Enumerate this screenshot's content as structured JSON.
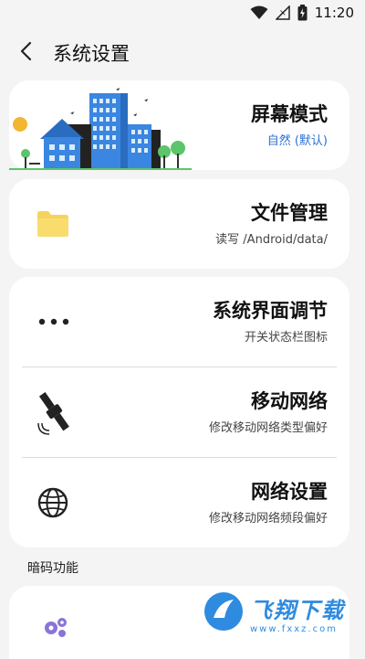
{
  "status_bar": {
    "time": "11:20",
    "icons": [
      "wifi-icon",
      "no-signal-icon",
      "battery-charging-icon"
    ]
  },
  "header": {
    "back_icon": "chevron-left-icon",
    "title": "系统设置"
  },
  "cards": {
    "display_mode": {
      "title": "屏幕模式",
      "subtitle": "自然 (默认)",
      "icon": "city-illustration"
    },
    "file_manager": {
      "title": "文件管理",
      "subtitle": "读写 /Android/data/",
      "icon": "folder-icon"
    },
    "system_ui": {
      "title": "系统界面调节",
      "subtitle": "开关状态栏图标",
      "icon": "more-dots-icon"
    },
    "mobile_network": {
      "title": "移动网络",
      "subtitle": "修改移动网络类型偏好",
      "icon": "satellite-icon"
    },
    "network_settings": {
      "title": "网络设置",
      "subtitle": "修改移动网络频段偏好",
      "icon": "globe-icon"
    }
  },
  "section": {
    "secret_codes_label": "暗码功能"
  },
  "bottom_item": {
    "icon": "gear-cluster-icon"
  },
  "watermark": {
    "brand": "飞翔下载",
    "url": "www.fxxz.com"
  },
  "colors": {
    "background": "#f4f4f4",
    "card": "#ffffff",
    "accent": "#2b6fd6",
    "folder": "#f6d35c",
    "gear": "#8b74d6"
  }
}
